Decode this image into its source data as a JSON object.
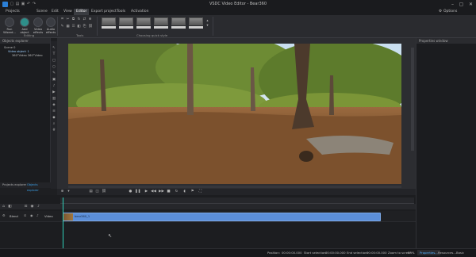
{
  "app": {
    "title": "VSDC Video Editor - Bear360"
  },
  "menu": {
    "tabs": [
      "Projects",
      "Scene",
      "Edit",
      "View",
      "Editor",
      "Export project",
      "Tools",
      "Activation"
    ],
    "active_tab": "Editor",
    "options_label": "Options"
  },
  "ribbon": {
    "run_wizard": "Run Wizard...",
    "add_object": "Add object",
    "video_effects": "Video effects",
    "audio_effects": "Audio effects",
    "editing_group": "Editing",
    "tools_group": "Tools",
    "quick_style_group": "Choosing quick style"
  },
  "left_panel": {
    "header": "Objects explorer",
    "tree": [
      "Scene 0",
      "Video object: 1",
      "360°Video 360°Video"
    ],
    "tabs": [
      "Projects explorer",
      "Objects explorer"
    ],
    "active_tab": "Objects explorer"
  },
  "right_panel": {
    "header": "Properties window"
  },
  "timeline": {
    "track_label": "Blend",
    "track_type": "Video",
    "clip_label": "bear360_1"
  },
  "status": {
    "position_label": "Position:",
    "position": "00:00:00.000",
    "start_selection_label": "Start selection:",
    "start_selection": "00:00:00.000",
    "end_selection_label": "End selection:",
    "end_selection": "00:00:00.000",
    "zoom_label": "Zoom to screen",
    "zoom": "33%"
  },
  "right_tabs": [
    "Properties...",
    "Resources...",
    "Basic effect..."
  ],
  "active_right_tab": "Properties..."
}
